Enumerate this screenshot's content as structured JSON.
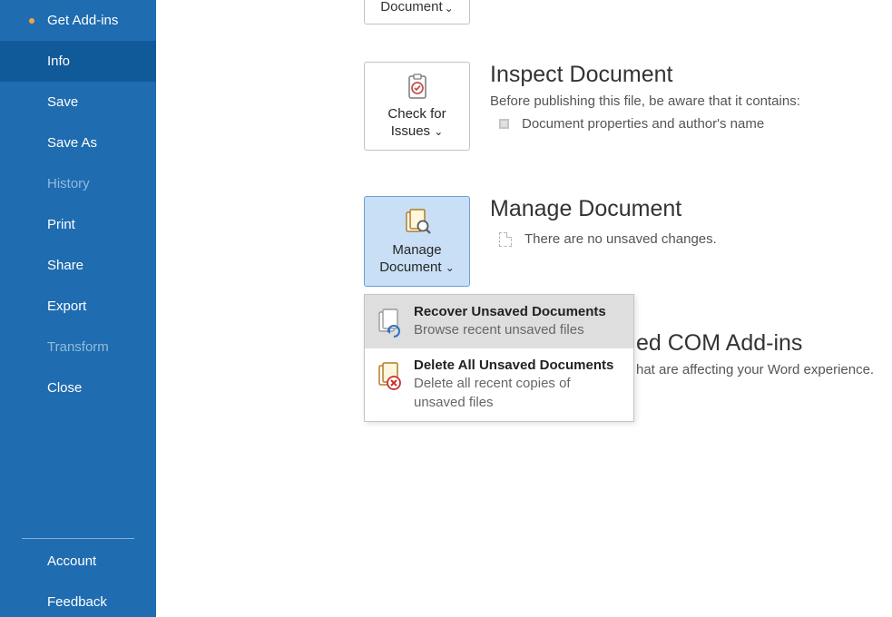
{
  "sidebar": {
    "items": [
      {
        "label": "Get Add-ins",
        "bullet": true
      },
      {
        "label": "Info"
      },
      {
        "label": "Save"
      },
      {
        "label": "Save As"
      },
      {
        "label": "History"
      },
      {
        "label": "Print"
      },
      {
        "label": "Share"
      },
      {
        "label": "Export"
      },
      {
        "label": "Transform"
      },
      {
        "label": "Close"
      }
    ],
    "bottom": [
      {
        "label": "Account"
      },
      {
        "label": "Feedback"
      }
    ]
  },
  "partial_button": {
    "label": "Document"
  },
  "sections": {
    "inspect": {
      "button_line1": "Check for",
      "button_line2": "Issues",
      "title": "Inspect Document",
      "desc": "Before publishing this file, be aware that it contains:",
      "bullet1": "Document properties and author's name"
    },
    "manage": {
      "button_line1": "Manage",
      "button_line2": "Document",
      "title": "Manage Document",
      "desc": "There are no unsaved changes."
    },
    "com": {
      "title_suffix": "ed COM Add-ins",
      "desc_suffix": "hat are affecting your Word experience."
    }
  },
  "dropdown": {
    "recover": {
      "title": "Recover Unsaved Documents",
      "desc": "Browse recent unsaved files"
    },
    "delete": {
      "title": "Delete All Unsaved Documents",
      "desc": "Delete all recent copies of unsaved files"
    }
  }
}
